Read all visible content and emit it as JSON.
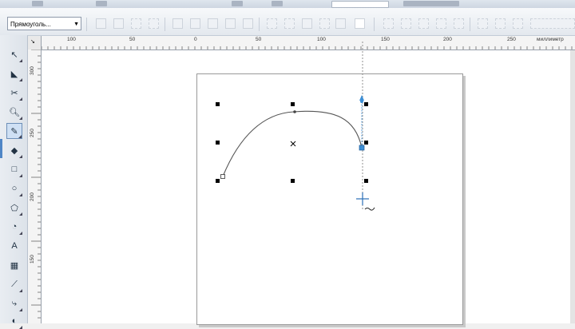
{
  "toolbar": {
    "shape_combo": "Прямоуголь...",
    "units_label": "миллиметр"
  },
  "ruler": {
    "h_ticks": [
      "100",
      "50",
      "0",
      "50",
      "100",
      "150",
      "200",
      "250"
    ],
    "v_ticks": [
      "300",
      "250",
      "200",
      "150"
    ],
    "units": "миллиметр"
  },
  "icons": {
    "pick": "pointer-icon",
    "shape": "shape-edit-icon",
    "crop": "crop-icon",
    "zoom": "zoom-icon",
    "freehand": "freehand-icon",
    "smart_fill": "smart-fill-icon",
    "rectangle": "rectangle-icon",
    "ellipse": "ellipse-icon",
    "polygon": "polygon-icon",
    "basic_shapes": "basic-shapes-icon",
    "text": "text-icon",
    "table": "table-icon",
    "dimension": "dimension-icon",
    "connector": "connector-icon",
    "blend": "blend-icon"
  },
  "colors": {
    "accent": "#4f86c6",
    "node_blue": "#3d8fd6",
    "handle": "#000000"
  }
}
